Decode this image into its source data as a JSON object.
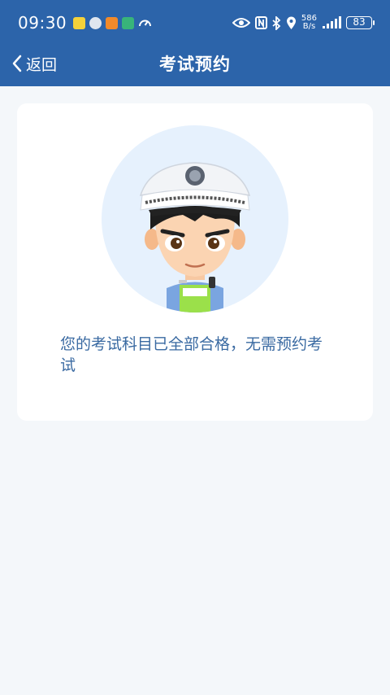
{
  "status_bar": {
    "time": "09:30",
    "net_speed_value": "586",
    "net_speed_unit": "B/s",
    "battery": "83"
  },
  "nav": {
    "back_label": "返回",
    "title": "考试预约"
  },
  "card": {
    "message": "您的考试科目已全部合格，无需预约考试",
    "illustration": "traffic-police-avatar"
  },
  "colors": {
    "header_bg": "#2c64aa",
    "page_bg": "#f4f7fa",
    "message_text": "#3a6aa2",
    "avatar_circle": "#e6f1fd"
  }
}
